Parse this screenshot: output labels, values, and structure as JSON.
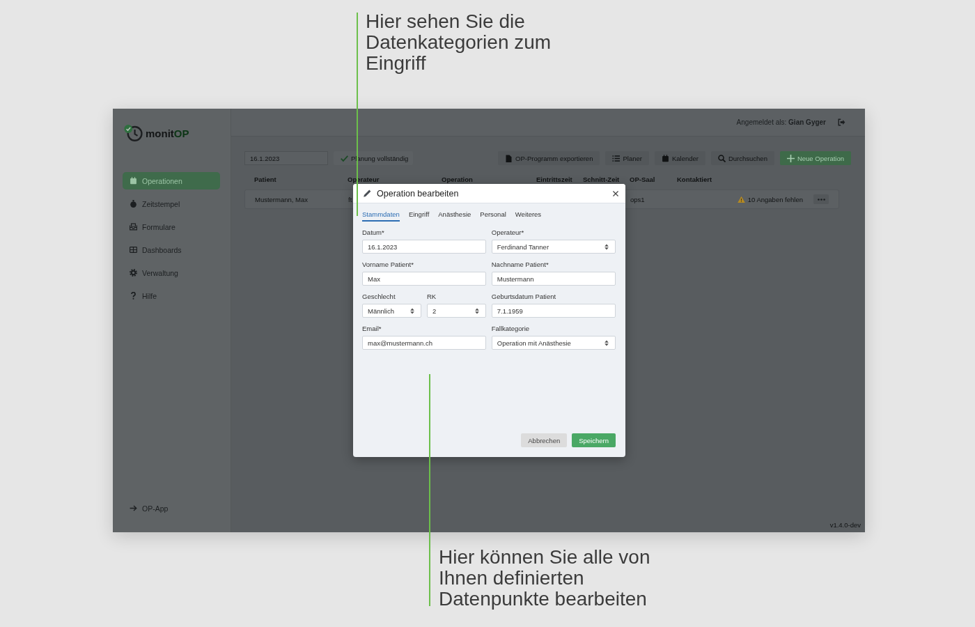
{
  "annotations": [
    {
      "text": "Hier sehen Sie die Datenkategorien zum Eingriff"
    },
    {
      "text": "Hier können Sie alle von Ihnen definierten Datenpunkte bearbeiten"
    }
  ],
  "sidebar": {
    "logo": {
      "text": "monit",
      "accent": "OP"
    },
    "items": [
      {
        "label": "Operationen",
        "selected": true
      },
      {
        "label": "Zeitstempel",
        "selected": false
      },
      {
        "label": "Formulare",
        "selected": false
      },
      {
        "label": "Dashboards",
        "selected": false
      },
      {
        "label": "Verwaltung",
        "selected": false
      },
      {
        "label": "Hilfe",
        "selected": false
      }
    ],
    "footer_link": "OP-App"
  },
  "header": {
    "user": "Angemeldet als: **Gian Gyger**"
  },
  "toolbar": {
    "date": "16.1.2023",
    "status_button": "Planung vollständig",
    "buttons": [
      {
        "label": "OP-Programm exportieren",
        "kind": "default"
      },
      {
        "label": "Planer",
        "kind": "default"
      },
      {
        "label": "Kalender",
        "kind": "default"
      },
      {
        "label": "Durchsuchen",
        "kind": "default"
      },
      {
        "label": "Neue Operation",
        "kind": "primary"
      }
    ]
  },
  "table": {
    "columns": [
      "Patient",
      "Operateur",
      "Operation",
      "Eintrittszeit",
      "Schnitt-Zeit",
      "OP-Saal",
      "Kontaktiert"
    ],
    "rows": [
      {
        "patient": "Mustermann, Max",
        "operateur": "ft",
        "op_saal": "ops1",
        "warning": "10 Angaben fehlen"
      }
    ]
  },
  "version": "v1.4.0-dev",
  "dialog": {
    "title": "Operation bearbeiten",
    "tabs": [
      {
        "label": "Stammdaten",
        "selected": true
      },
      {
        "label": "Eingriff",
        "selected": false
      },
      {
        "label": "Anästhesie",
        "selected": false
      },
      {
        "label": "Personal",
        "selected": false
      },
      {
        "label": "Weiteres",
        "selected": false
      }
    ],
    "rows": [
      {
        "fields": [
          {
            "label": "Datum*",
            "value": "16.1.2023",
            "kind": "text"
          },
          {
            "label": "Operateur*",
            "value": "Ferdinand Tanner",
            "kind": "select"
          }
        ]
      },
      {
        "fields": [
          {
            "label": "Vorname Patient*",
            "value": "Max",
            "kind": "text"
          },
          {
            "label": "Nachname Patient*",
            "value": "Mustermann",
            "kind": "text"
          }
        ]
      },
      {
        "fields": [
          {
            "label": "Geschlecht",
            "value": "Männlich",
            "kind": "select"
          },
          {
            "label": "RK",
            "value": "2",
            "kind": "select"
          },
          {
            "label": "Geburtsdatum Patient",
            "value": "7.1.1959",
            "kind": "text"
          }
        ]
      },
      {
        "fields": [
          {
            "label": "Email*",
            "value": "max@mustermann.ch",
            "kind": "text"
          },
          {
            "label": "Fallkategorie",
            "value": "Operation mit Anästhesie",
            "kind": "select"
          }
        ]
      }
    ],
    "buttons": [
      {
        "label": "Abbrechen",
        "kind": "secondary"
      },
      {
        "label": "Speichern",
        "kind": "primary"
      }
    ]
  }
}
